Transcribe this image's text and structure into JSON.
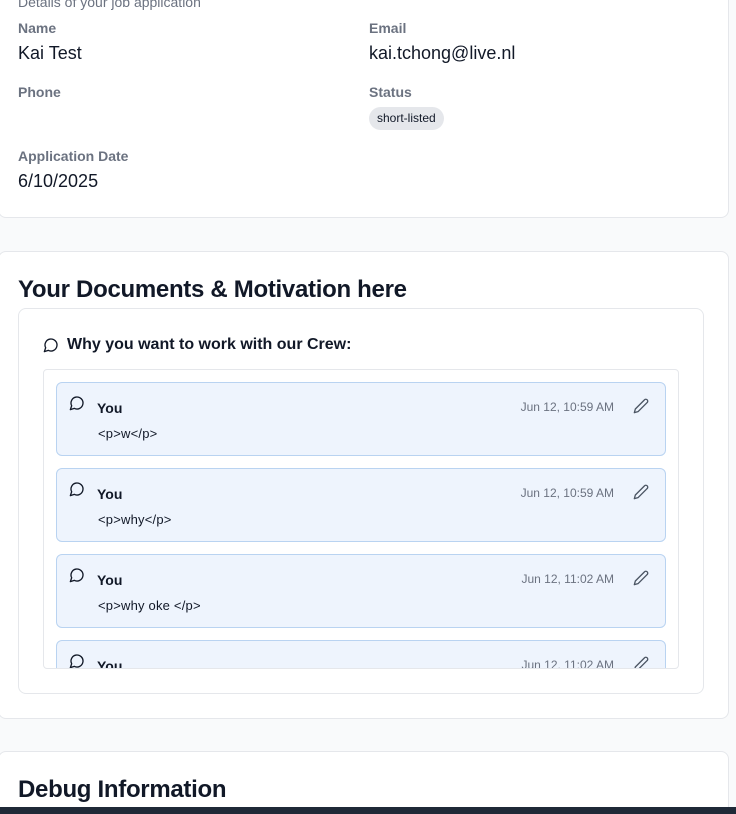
{
  "details": {
    "subtitle": "Details of your job application",
    "fields": {
      "name_label": "Name",
      "name_value": "Kai Test",
      "email_label": "Email",
      "email_value": "kai.tchong@live.nl",
      "phone_label": "Phone",
      "phone_value": "",
      "status_label": "Status",
      "status_value": "short-listed",
      "date_label": "Application Date",
      "date_value": "6/10/2025"
    }
  },
  "documents": {
    "title": "Your Documents & Motivation here",
    "question": "Why you want to work with our Crew:",
    "comments": [
      {
        "author": "You",
        "time": "Jun 12, 10:59 AM",
        "body": "<p>w</p>"
      },
      {
        "author": "You",
        "time": "Jun 12, 10:59 AM",
        "body": "<p>why</p>"
      },
      {
        "author": "You",
        "time": "Jun 12, 11:02 AM",
        "body": "<p>why oke </p>"
      },
      {
        "author": "You",
        "time": "Jun 12, 11:02 AM",
        "body": ""
      }
    ]
  },
  "debug": {
    "title": "Debug Information"
  },
  "colors": {
    "comment_bg": "#eef4fd",
    "comment_border": "#b9d3f1",
    "badge_bg": "#e5e7eb"
  }
}
